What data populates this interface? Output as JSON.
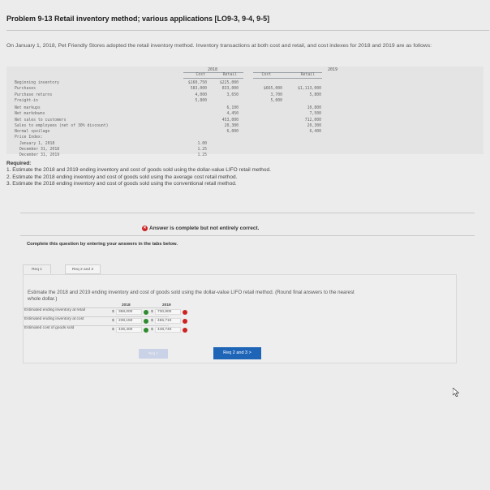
{
  "title": "Problem 9-13 Retail inventory method; various applications [LO9-3, 9-4, 9-5]",
  "intro": "On January 1, 2018, Pet Friendly Stores adopted the retail inventory method. Inventory transactions at both cost and retail, and cost indexes for 2018 and 2019 are as follows:",
  "table": {
    "year_2018": "2018",
    "year_2019": "2019",
    "col_cost": "Cost",
    "col_retail": "Retail",
    "rows": [
      {
        "label": "Beginning inventory",
        "c18": "$160,750",
        "r18": "$225,000",
        "c19": "",
        "r19": ""
      },
      {
        "label": "Purchases",
        "c18": "583,000",
        "r18": "833,000",
        "c19": "$665,000",
        "r19": "$1,113,000"
      },
      {
        "label": "Purchase returns",
        "c18": "4,000",
        "r18": "3,650",
        "c19": "3,700",
        "r19": "5,800"
      },
      {
        "label": "Freight-in",
        "c18": "5,800",
        "r18": "",
        "c19": "5,000",
        "r19": ""
      },
      {
        "label": "Net markups",
        "c18": "",
        "r18": "6,100",
        "c19": "",
        "r19": "10,800"
      },
      {
        "label": "Net markdowns",
        "c18": "",
        "r18": "4,450",
        "c19": "",
        "r19": "7,500"
      },
      {
        "label": "Net sales to customers",
        "c18": "",
        "r18": "453,000",
        "c19": "",
        "r19": "712,000"
      },
      {
        "label": "Sales to employees (net of 30% discount)",
        "c18": "",
        "r18": "20,300",
        "c19": "",
        "r19": "20,300"
      },
      {
        "label": "Normal spoilage",
        "c18": "",
        "r18": "6,000",
        "c19": "",
        "r19": "6,400"
      },
      {
        "label": "Price Index:",
        "c18": "",
        "r18": "",
        "c19": "",
        "r19": ""
      },
      {
        "label": "January 1, 2018",
        "c18": "1.00",
        "r18": "",
        "c19": "",
        "r19": ""
      },
      {
        "label": "December 31, 2018",
        "c18": "1.25",
        "r18": "",
        "c19": "",
        "r19": ""
      },
      {
        "label": "December 31, 2019",
        "c18": "1.25",
        "r18": "",
        "c19": "",
        "r19": ""
      }
    ]
  },
  "required": {
    "heading": "Required:",
    "items": [
      "1. Estimate the 2018 and 2019 ending inventory and cost of goods sold using the dollar-value LIFO retail method.",
      "2. Estimate the 2018 ending inventory and cost of goods sold using the average cost retail method.",
      "3. Estimate the 2018 ending inventory and cost of goods sold using the conventional retail method."
    ]
  },
  "status": {
    "message": "Answer is complete but not entirely correct.",
    "status_color": "#cc2222"
  },
  "complete_prompt": "Complete this question by entering your answers in the tabs below.",
  "tabs": [
    {
      "label": "Req 1",
      "active": true
    },
    {
      "label": "Req 2 and 3",
      "active": false
    }
  ],
  "instruction": "Estimate the 2018 and 2019 ending inventory and cost of goods sold using the dollar-value LIFO retail method. (Round final answers to the nearest whole dollar.)",
  "answer_table": {
    "col_2018": "2018",
    "col_2019": "2019",
    "rows": [
      {
        "label": "Estimated ending inventory at retail",
        "v2018": "368,000",
        "s2018": "correct",
        "v2019": "730,800",
        "s2019": "incorrect"
      },
      {
        "label": "Estimated ending inventory at cost",
        "v2018": "238,150",
        "s2018": "correct",
        "v2019": "455,710",
        "s2019": "incorrect"
      },
      {
        "label": "Estimated cost of goods sold",
        "v2018": "435,400",
        "s2018": "correct",
        "v2019": "448,740",
        "s2019": "incorrect"
      }
    ]
  },
  "nav": {
    "prev": "Req 1",
    "next": "Req 2 and 3 >"
  }
}
